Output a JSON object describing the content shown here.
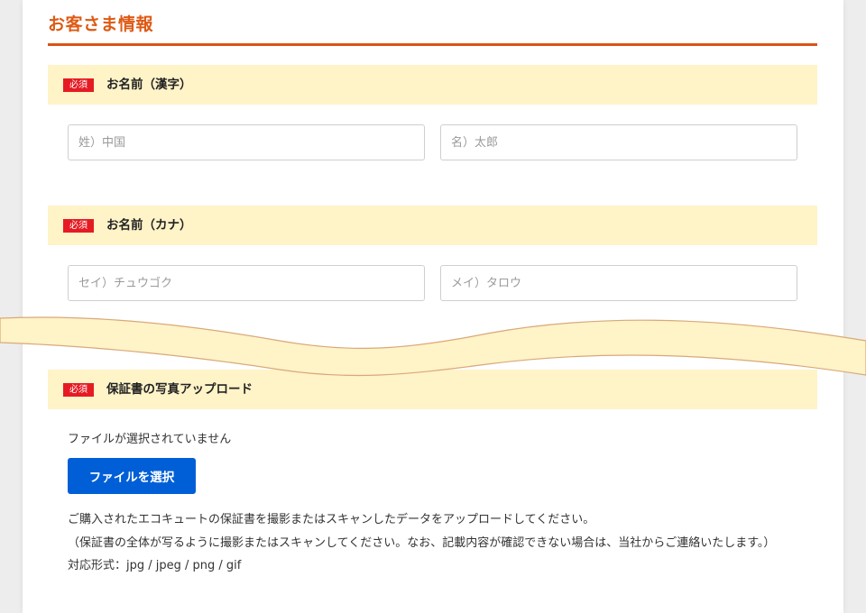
{
  "page": {
    "title": "お客さま情報"
  },
  "sections": {
    "name_kanji": {
      "required_badge": "必須",
      "label": "お名前（漢字）",
      "last_name_placeholder": "姓）中国",
      "first_name_placeholder": "名）太郎"
    },
    "name_kana": {
      "required_badge": "必須",
      "label": "お名前（カナ）",
      "last_name_placeholder": "セイ）チュウゴク",
      "first_name_placeholder": "メイ）タロウ"
    },
    "warranty_upload": {
      "required_badge": "必須",
      "label": "保証書の写真アップロード",
      "file_status": "ファイルが選択されていません",
      "file_button_label": "ファイルを選択",
      "note_line1": "ご購入されたエコキュートの保証書を撮影またはスキャンしたデータをアップロードしてください。",
      "note_line2": "（保証書の全体が写るように撮影またはスキャンしてください。なお、記載内容が確認できない場合は、当社からご連絡いたします。）",
      "formats": "対応形式：jpg / jpeg / png / gif"
    }
  },
  "colors": {
    "title": "#de5a15",
    "title_rule": "#d9541a",
    "section_bg": "#fff3c8",
    "required_badge": "#e51b24",
    "primary_button": "#005fd6",
    "cut_wave_fill": "#fff3c8",
    "cut_wave_stroke": "#d9a878"
  }
}
